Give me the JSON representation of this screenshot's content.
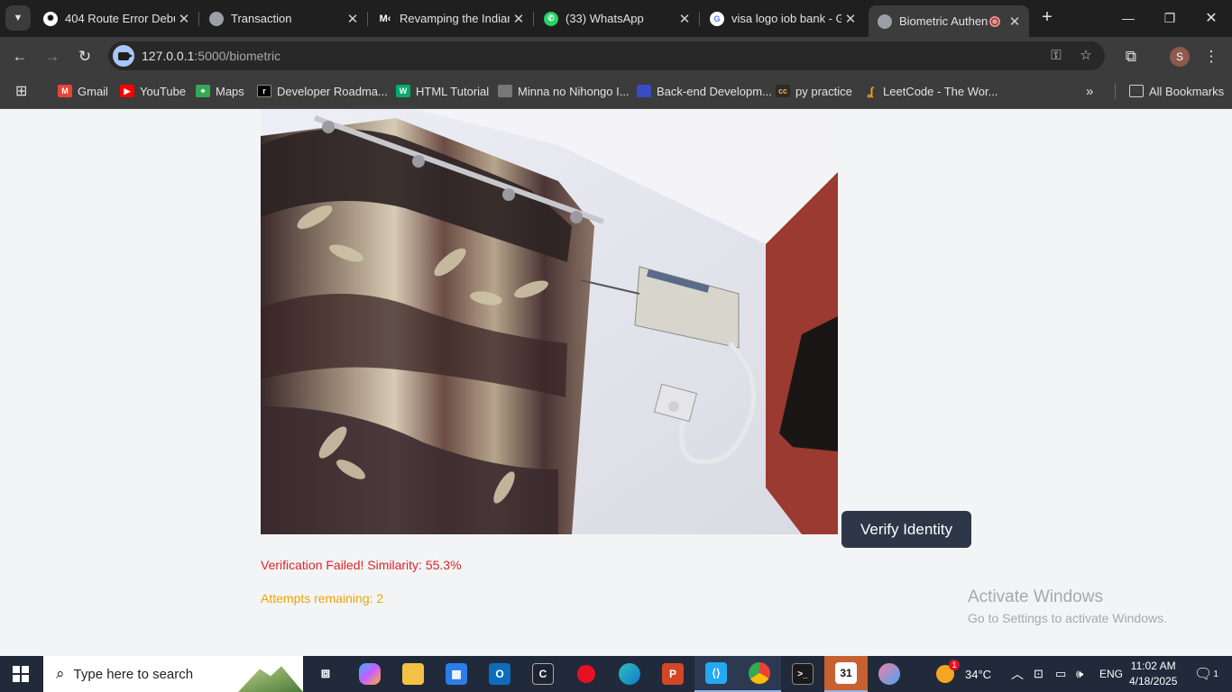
{
  "browser": {
    "tabs": [
      {
        "title": "404 Route Error Debu",
        "icon": "chatgpt-icon",
        "close": "✕"
      },
      {
        "title": "Transaction",
        "icon": "globe-icon",
        "close": "✕"
      },
      {
        "title": "Revamping the Indian",
        "icon": "medium-icon",
        "icon_text": "M‹",
        "close": "✕"
      },
      {
        "title": "(33) WhatsApp",
        "icon": "whatsapp-icon",
        "close": "✕"
      },
      {
        "title": "visa logo iob bank - G",
        "icon": "google-icon",
        "icon_text": "G",
        "close": "✕"
      },
      {
        "title": "Biometric Authen",
        "icon": "globe-icon",
        "close": "✕"
      }
    ],
    "url_host": "127.0.0.1",
    "url_path": ":5000/biometric",
    "bookmarks": [
      {
        "label": "Gmail",
        "icon": "gmail-icon",
        "color": "#ea4335"
      },
      {
        "label": "YouTube",
        "icon": "youtube-icon",
        "color": "#ff0000"
      },
      {
        "label": "Maps",
        "icon": "maps-icon",
        "color": "#34a853"
      },
      {
        "label": "Developer Roadma...",
        "icon": "roadmap-icon",
        "color": "#000000"
      },
      {
        "label": "HTML Tutorial",
        "icon": "w3schools-icon",
        "color": "#04aa6d"
      },
      {
        "label": "Minna no Nihongo I...",
        "icon": "book-icon",
        "color": "#777777"
      },
      {
        "label": "Back-end Developm...",
        "icon": "backend-icon",
        "color": "#3a4bc6"
      },
      {
        "label": "py practice",
        "icon": "cc-icon",
        "color": "#2b2b2b",
        "icon_text": "cc"
      },
      {
        "label": "LeetCode - The Wor...",
        "icon": "leetcode-icon",
        "color": "#ffa116"
      }
    ],
    "all_bookmarks": "All Bookmarks"
  },
  "page": {
    "verify_button": "Verify Identity",
    "status_message": "Verification Failed! Similarity: 55.3%",
    "attempts_message": "Attempts remaining: 2",
    "activate_title": "Activate Windows",
    "activate_subtitle": "Go to Settings to activate Windows.",
    "colors": {
      "fail": "#e02424",
      "attempts": "#f0a500",
      "button": "#2d3748"
    }
  },
  "taskbar": {
    "search_placeholder": "Type here to search",
    "weather_temp": "34°C",
    "language": "ENG",
    "time": "11:02 AM",
    "date": "4/18/2025",
    "notification_count": "1",
    "weather_badge": "1",
    "calendar_day": "31"
  }
}
